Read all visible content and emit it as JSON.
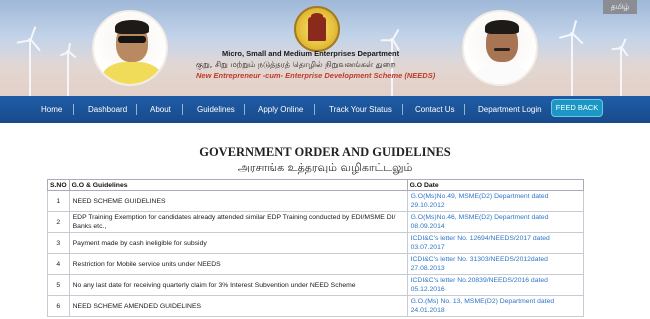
{
  "header": {
    "lang_toggle": "தமிழ்",
    "dept_en": "Micro, Small and Medium Enterprises Department",
    "dept_ta": "குறு, சிறு மற்றும் நடுத்தரத் தொழில் நிறுவனங்கள் துறை",
    "scheme": "New Entrepreneur -cum- Enterprise Development Scheme (NEEDS)"
  },
  "nav": {
    "items": [
      "Home",
      "Dashboard",
      "About",
      "Guidelines",
      "Apply Online",
      "Track Your Status",
      "Contact Us",
      "Department Login"
    ],
    "feedback": "FEED BACK"
  },
  "page": {
    "title_en": "GOVERNMENT ORDER AND GUIDELINES",
    "title_ta": "அரசாங்க உத்தரவும் வழிகாட்டலும்"
  },
  "table": {
    "headers": [
      "S.NO",
      "G.O & Guidelines",
      "G.O Date"
    ],
    "rows": [
      {
        "sno": "1",
        "desc": "NEED SCHEME GUIDELINES",
        "date": "G.O(Ms)No.49, MSME(D2) Department dated 29.10.2012"
      },
      {
        "sno": "2",
        "desc": "EDP Training Exemption for candidates already attended similar EDP Training conducted by EDI/MSME DI/ Banks etc.,",
        "date": "G.O(Ms)No.46, MSME(D2) Department dated 08.09.2014"
      },
      {
        "sno": "3",
        "desc": "Payment made by cash ineligible for subsidy",
        "date": "ICDI&C's letter No. 12694/NEEDS/2017 dated 03.07.2017"
      },
      {
        "sno": "4",
        "desc": "Restriction for Mobile service units under NEEDS",
        "date": "ICDI&C's letter No. 31303/NEEDS/2012dated 27.08.2013"
      },
      {
        "sno": "5",
        "desc": "No any last date for receiving quarterly claim for 3% Interest Subvention under NEED Scheme",
        "date": "ICDI&C's letter No.20839/NEEDS/2016 dated 05.12.2016"
      },
      {
        "sno": "6",
        "desc": "NEED SCHEME AMENDED GUIDELINES",
        "date": "G.O.(Ms) No. 13, MSME(D2) Department dated 24.01.2018"
      }
    ]
  },
  "colors": {
    "nav_bg": "#1f5ca6",
    "feedback_bg": "#1b97c5",
    "link": "#2e75c8",
    "scheme_red": "#c0392b"
  }
}
